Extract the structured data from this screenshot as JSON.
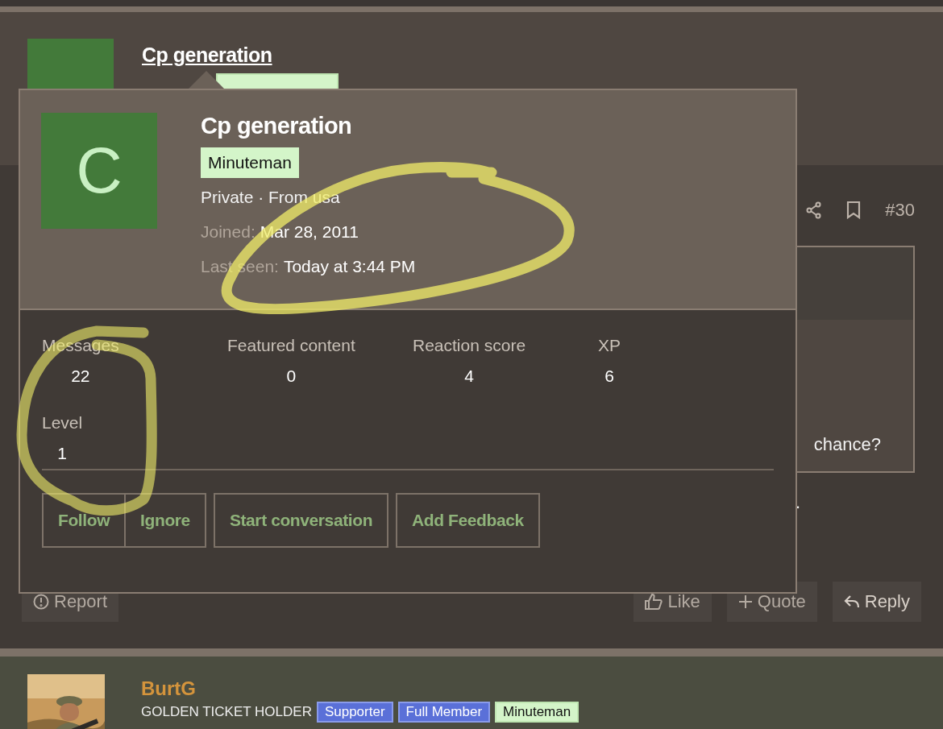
{
  "post": {
    "author": "Cp generation",
    "number": "#30",
    "quote_text": "chance?",
    "body_tail": ".",
    "actions_left": [
      {
        "label": "Report"
      }
    ],
    "actions_right": [
      {
        "label": "Like"
      },
      {
        "label": "Quote"
      },
      {
        "label": "Reply"
      }
    ]
  },
  "member_card": {
    "avatar_letter": "C",
    "name": "Cp generation",
    "banner": "Minuteman",
    "title_line": "Private · From usa",
    "details": [
      {
        "label": "Joined:",
        "value": "Mar 28, 2011"
      },
      {
        "label": "Last seen:",
        "value": "Today at 3:44 PM"
      }
    ],
    "stats": [
      {
        "label": "Messages",
        "value": "22"
      },
      {
        "label": "Featured content",
        "value": "0"
      },
      {
        "label": "Reaction score",
        "value": "4"
      },
      {
        "label": "XP",
        "value": "6"
      },
      {
        "label": "Level",
        "value": "1"
      }
    ],
    "button_groups": [
      {
        "buttons": [
          {
            "label": "Follow"
          },
          {
            "label": "Ignore"
          }
        ]
      },
      {
        "buttons": [
          {
            "label": "Start conversation"
          }
        ]
      },
      {
        "buttons": [
          {
            "label": "Add Feedback"
          }
        ]
      }
    ]
  },
  "next_post": {
    "author": "BurtG",
    "user_title": "GOLDEN TICKET HOLDER",
    "banners": [
      {
        "label": "Supporter",
        "color": "#5a70d8"
      },
      {
        "label": "Full Member",
        "color": "#5a70d8"
      },
      {
        "label": "Minuteman",
        "color": "#d4f5c9"
      }
    ]
  }
}
